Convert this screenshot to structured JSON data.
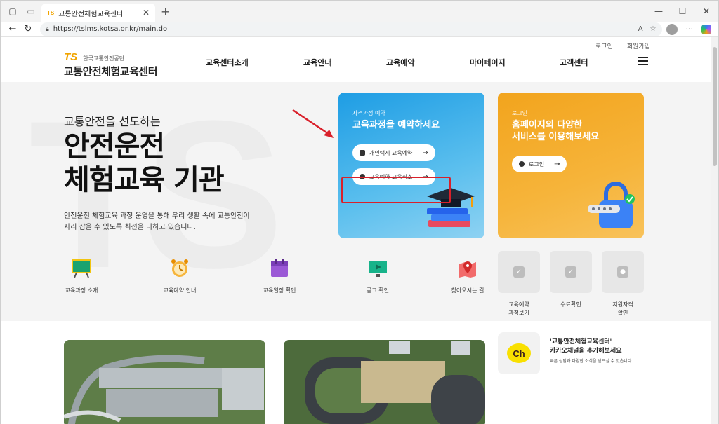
{
  "browser": {
    "tab_title": "교통안전체험교육센터",
    "tab_favicon": "TS",
    "url": "https://tslms.kotsa.or.kr/main.do"
  },
  "header": {
    "top_links": [
      "로그인",
      "회원가입"
    ],
    "logo_mark": "TS",
    "logo_org": "한국교통안전공단",
    "logo_title": "교통안전체험교육센터",
    "nav": [
      "교육센터소개",
      "교육안내",
      "교육예약",
      "마이페이지",
      "고객센터"
    ]
  },
  "hero": {
    "watermark": "TS",
    "subtitle": "교통안전을 선도하는",
    "title_line1": "안전운전",
    "title_line2": "체험교육 기관",
    "desc_line1": "안전운전 체험교육 과정 운영을 통해 우리 생활 속에 교통안전이",
    "desc_line2": "자리 잡을 수 있도록 최선을 다하고 있습니다."
  },
  "reserve_card": {
    "eyebrow": "자격과정 예약",
    "title": "교육과정을 예약하세요",
    "btn_primary": "개인택시 교육예약",
    "btn_secondary": "교육예약 교육취소",
    "accent": "#1e9de4"
  },
  "login_card": {
    "eyebrow": "로그인",
    "title_line1": "홈페이지의 다양한",
    "title_line2": "서비스를 이용해보세요",
    "btn": "로그인",
    "accent": "#f2a41d"
  },
  "quick_links": [
    {
      "label": "교육과정 소개",
      "icon": "blackboard-icon"
    },
    {
      "label": "교육예약 안내",
      "icon": "alarm-clock-icon"
    },
    {
      "label": "교육일정 확인",
      "icon": "calendar-icon"
    },
    {
      "label": "공고 확인",
      "icon": "monitor-icon"
    },
    {
      "label": "찾아오시는 길",
      "icon": "map-pin-icon"
    }
  ],
  "mini_cards": [
    {
      "label_line1": "교육예약",
      "label_line2": "과정보기",
      "icon": "calendar-check-icon"
    },
    {
      "label_line1": "수료확인",
      "label_line2": "",
      "icon": "check-box-icon"
    },
    {
      "label_line1": "지원자격",
      "label_line2": "확인",
      "icon": "user-card-icon"
    }
  ],
  "kakao": {
    "logo": "Ch",
    "title_line1": "'교통안전체험교육센터'",
    "title_line2": "카카오채널을 추가해보세요",
    "desc": "빠른 상담과 다양한 소식을 받으실 수 있습니다"
  }
}
